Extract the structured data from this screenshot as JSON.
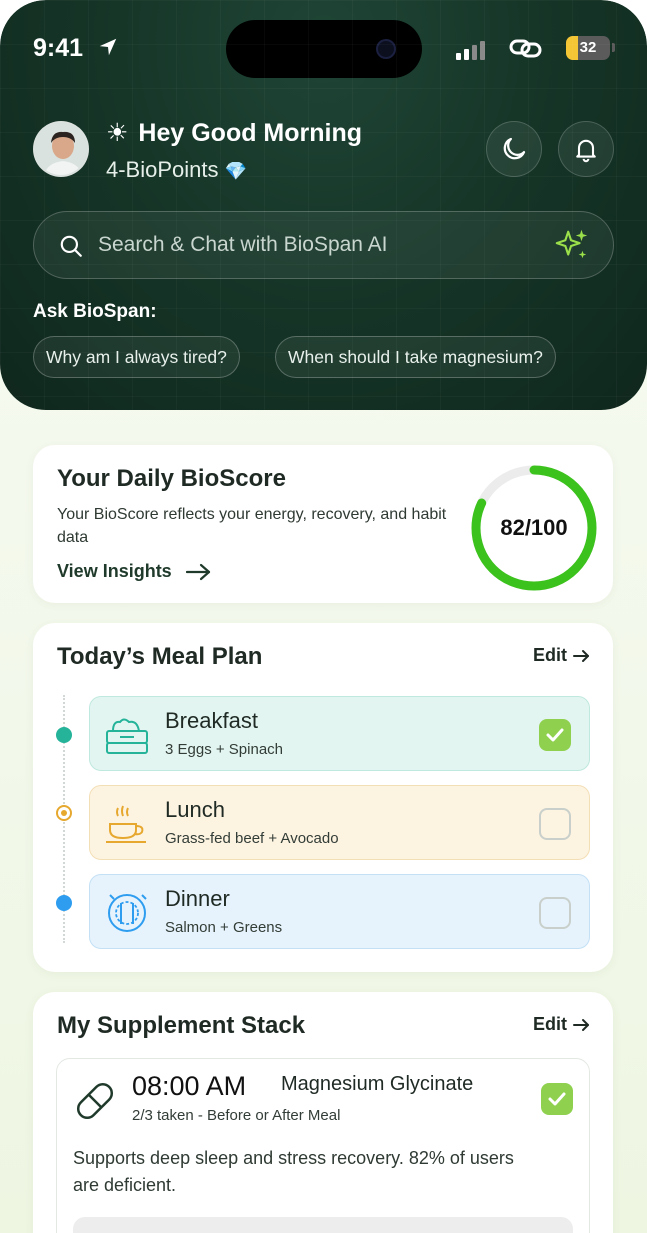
{
  "status_bar": {
    "time": "9:41",
    "battery": "32"
  },
  "header": {
    "greeting": "Hey Good Morning",
    "greeting_icon": "sun-icon",
    "points": "4-BioPoints",
    "points_icon": "diamond-icon",
    "buttons": [
      "moon-icon",
      "bell-icon"
    ]
  },
  "search": {
    "placeholder": "Search & Chat with BioSpan AI",
    "icons": [
      "search-icon",
      "sparkle-icon"
    ]
  },
  "ask": {
    "label": "Ask BioSpan:",
    "chips": [
      "Why am I always tired?",
      "When should I take magnesium?"
    ]
  },
  "bioscore": {
    "title": "Your Daily BioScore",
    "description": "Your BioScore reflects your energy, recovery, and habit data",
    "link": "View Insights",
    "score_text": "82/100",
    "score": 82,
    "max": 100,
    "ring_color": "#3cc21c"
  },
  "meal_plan": {
    "title": "Today’s Meal Plan",
    "edit": "Edit",
    "meals": [
      {
        "name": "Breakfast",
        "desc": "3 Eggs + Spinach",
        "icon": "food-tray-icon",
        "checked": true,
        "bg": "#e3f5f1",
        "dot": "#25b39a"
      },
      {
        "name": "Lunch",
        "desc": "Grass-fed beef + Avocado",
        "icon": "coffee-cup-icon",
        "checked": false,
        "bg": "#fdf3e1",
        "dot": "#e6a82e"
      },
      {
        "name": "Dinner",
        "desc": "Salmon + Greens",
        "icon": "plate-cutlery-icon",
        "checked": false,
        "bg": "#e6f3fc",
        "dot": "#2e9df0"
      }
    ]
  },
  "supplements": {
    "title": "My Supplement Stack",
    "edit": "Edit",
    "items": [
      {
        "time": "08:00 AM",
        "name": "Magnesium Glycinate",
        "taken": "2/3 taken - Before or After Meal",
        "description": "Supports deep sleep and stress recovery. 82% of users are deficient.",
        "checked": true,
        "icon": "pill-icon"
      }
    ]
  }
}
